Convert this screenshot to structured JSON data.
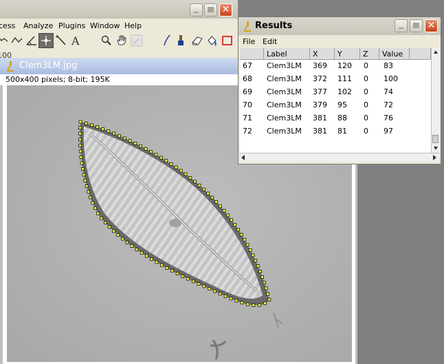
{
  "main_window": {
    "menus": [
      "cess",
      "Analyze",
      "Plugins",
      "Window",
      "Help"
    ],
    "tools": [
      "freehand-line-tool",
      "angle-tool",
      "point-tool",
      "wand-tool",
      "text-tool",
      "magnifier-tool",
      "hand-tool",
      "color-picker-tool",
      "line-tool",
      "brush-tool",
      "eraser-tool",
      "flood-fill-tool",
      "rectangle-tool"
    ],
    "selected_tool": "point-tool",
    "status_partial": "100"
  },
  "image_window": {
    "title": "Clem3LM.jpg",
    "info": "500x400 pixels; 8-bit; 195K"
  },
  "results_window": {
    "title": "Results",
    "menus": [
      "File",
      "Edit"
    ],
    "columns": [
      "",
      "Label",
      "X",
      "Y",
      "Z",
      "Value"
    ],
    "rows": [
      [
        "67",
        "Clem3LM",
        "369",
        "120",
        "0",
        "83"
      ],
      [
        "68",
        "Clem3LM",
        "372",
        "111",
        "0",
        "100"
      ],
      [
        "69",
        "Clem3LM",
        "377",
        "102",
        "0",
        "74"
      ],
      [
        "70",
        "Clem3LM",
        "379",
        "95",
        "0",
        "72"
      ],
      [
        "71",
        "Clem3LM",
        "381",
        "88",
        "0",
        "76"
      ],
      [
        "72",
        "Clem3LM",
        "381",
        "81",
        "0",
        "97"
      ]
    ]
  },
  "colors": {
    "selection_point": "#ffff33",
    "close_button": "#c6421a",
    "active_title": "#a9bbe0"
  }
}
